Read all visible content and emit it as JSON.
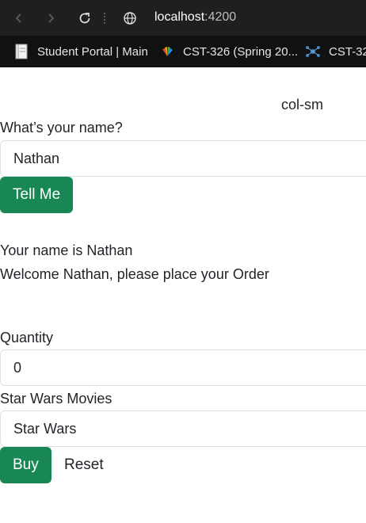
{
  "browser": {
    "url_host": "localhost",
    "url_port": ":4200",
    "bookmarks": [
      {
        "label": "Student Portal | Main",
        "icon": "notebook-icon"
      },
      {
        "label": "CST-326 (Spring 20...",
        "icon": "fan-logo-icon"
      },
      {
        "label": "CST-32",
        "icon": "network-icon"
      }
    ]
  },
  "page": {
    "col_label": "col-sm",
    "name_label": "What’s your name?",
    "name_value": "Nathan",
    "tell_me_button": "Tell Me",
    "your_name_text": "Your name is Nathan",
    "welcome_text": "Welcome Nathan, please place your Order",
    "quantity_label": "Quantity",
    "quantity_value": "0",
    "movies_label": "Star Wars Movies",
    "movies_value": "Star Wars",
    "buy_button": "Buy",
    "reset_button": "Reset"
  },
  "colors": {
    "success": "#198754",
    "chrome_bg": "#1f1f1f",
    "bookmarks_bg": "#111111"
  }
}
